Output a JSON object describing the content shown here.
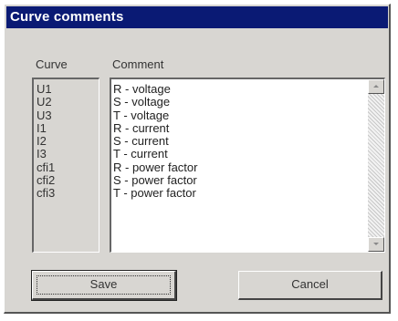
{
  "window": {
    "title": "Curve comments"
  },
  "headers": {
    "curve": "Curve",
    "comment": "Comment"
  },
  "curves": [
    "U1",
    "U2",
    "U3",
    "I1",
    "I2",
    "I3",
    "cfi1",
    "cfi2",
    "cfi3"
  ],
  "comments": [
    "R - voltage",
    "S - voltage",
    "T - voltage",
    "R - current",
    "S - current",
    "T - current",
    "R - power factor",
    "S - power factor",
    "T - power factor"
  ],
  "buttons": {
    "save": "Save",
    "cancel": "Cancel"
  },
  "icons": {
    "scroll_up": "arrow-up-icon",
    "scroll_down": "arrow-down-icon"
  },
  "colors": {
    "titlebar": "#0a1a74",
    "dialog": "#d8d6d2"
  }
}
